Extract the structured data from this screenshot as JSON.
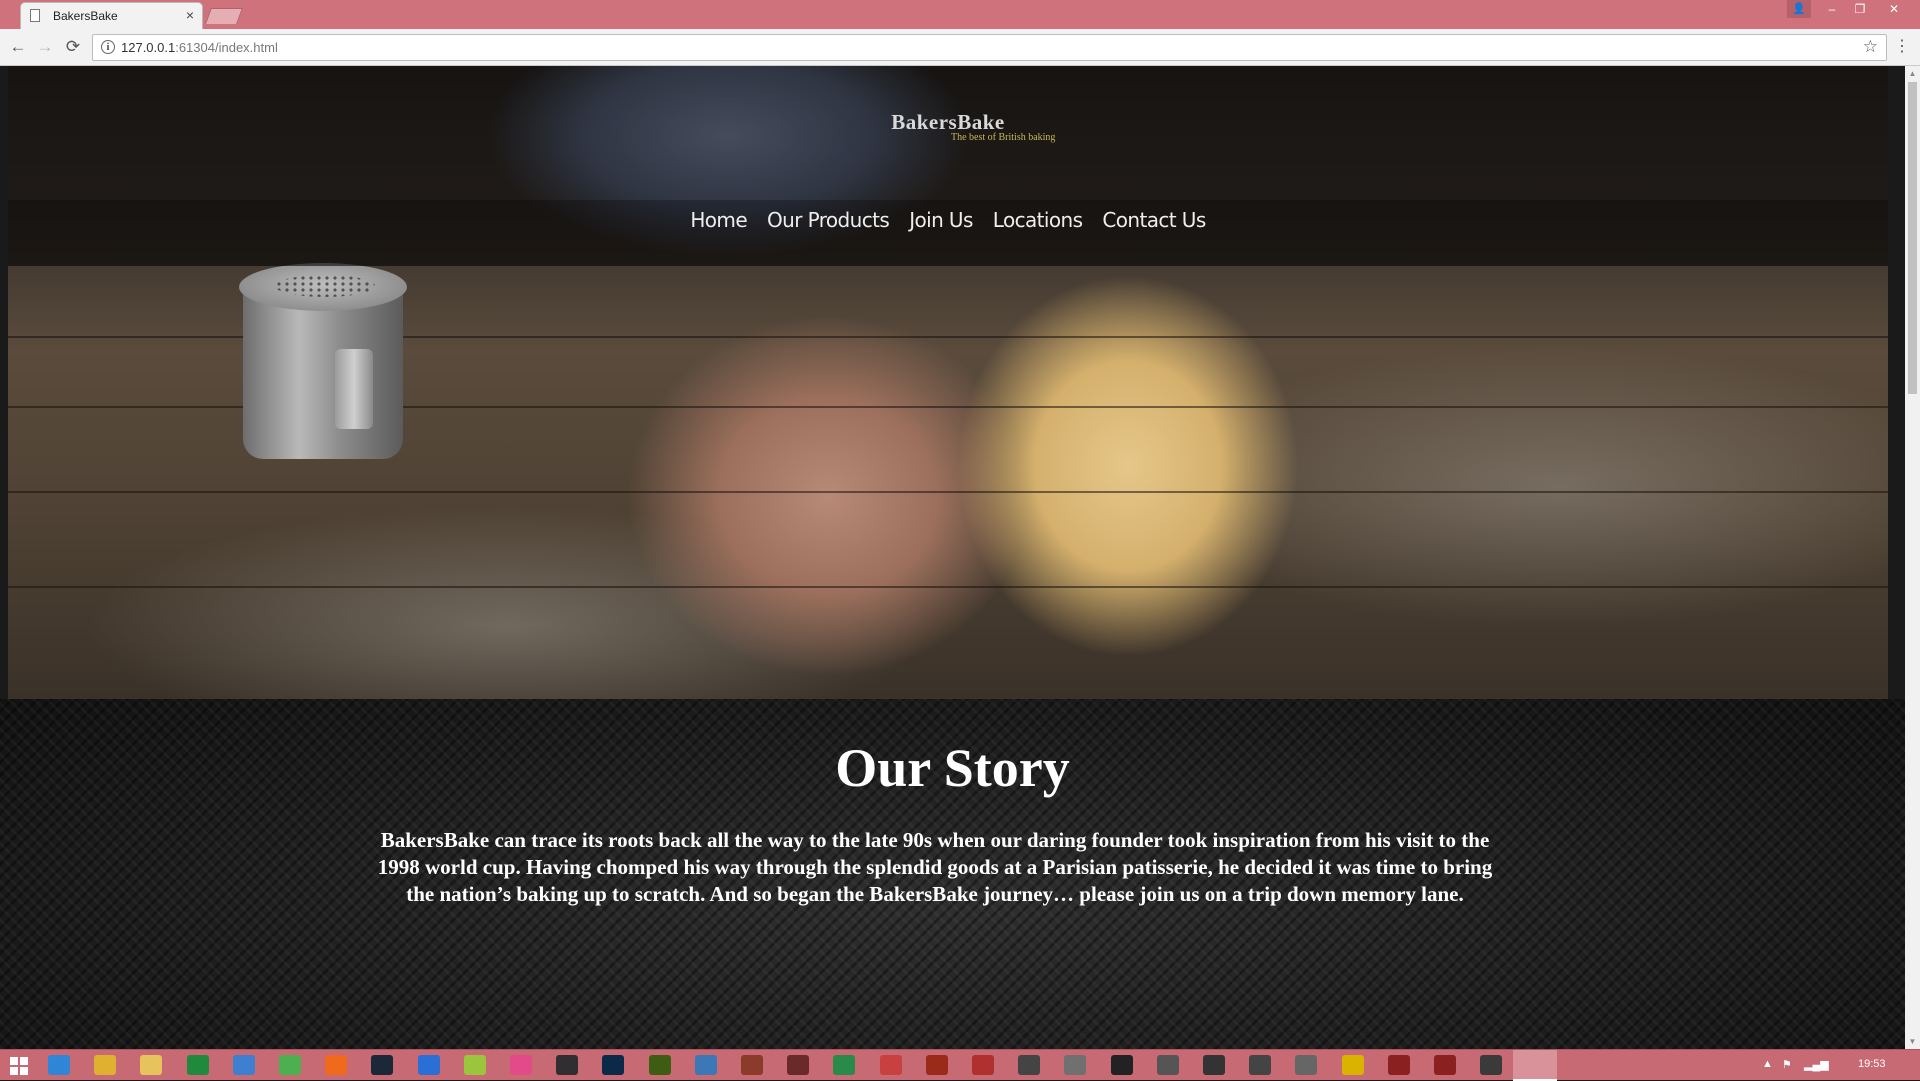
{
  "browser": {
    "tab_title": "BakersBake",
    "tab_close": "×",
    "url_host": "127.0.0.1",
    "url_rest": ":61304/index.html",
    "back": "←",
    "forward": "→",
    "reload": "⟳",
    "star": "☆",
    "menu": "⋮",
    "info": "i"
  },
  "window_controls": {
    "minimize": "–",
    "restore": "❐",
    "close": "✕",
    "user": "👤"
  },
  "site": {
    "brand_name": "BakersBake",
    "tagline": "The best of British baking",
    "nav": [
      "Home",
      "Our Products",
      "Join Us",
      "Locations",
      "Contact Us"
    ]
  },
  "story": {
    "heading": "Our Story",
    "body": "BakersBake can trace its roots back all the way to the late 90s when our daring founder took inspiration from his visit to the 1998 world cup. Having chomped his way through the splendid goods at a Parisian patisserie, he decided it was time to bring the nation’s baking up to scratch. And so began the BakersBake journey… please join us on a trip down memory lane."
  },
  "taskbar": {
    "clock": "19:53",
    "pinned_icons": [
      {
        "name": "ie-icon",
        "color": "#2f86d6"
      },
      {
        "name": "chrome-icon",
        "color": "#e0b030"
      },
      {
        "name": "file-explorer-icon",
        "color": "#e6c35c"
      },
      {
        "name": "excel-icon",
        "color": "#1f8a3c"
      },
      {
        "name": "keyboard-icon",
        "color": "#3f7fd0"
      },
      {
        "name": "green-app-icon",
        "color": "#4caf50"
      },
      {
        "name": "orange-app-icon",
        "color": "#f06a1e"
      },
      {
        "name": "steam-icon",
        "color": "#1b2838"
      },
      {
        "name": "blue-app-icon",
        "color": "#2a6fd6"
      },
      {
        "name": "lime-app-icon",
        "color": "#9bc53d"
      },
      {
        "name": "pink-app-icon",
        "color": "#e24a8a"
      },
      {
        "name": "obs-icon",
        "color": "#302e31"
      },
      {
        "name": "photoshop-icon",
        "color": "#0b2a4a"
      },
      {
        "name": "dreamweaver-icon",
        "color": "#3d5e12"
      },
      {
        "name": "visual-studio-icon",
        "color": "#3c78b5"
      },
      {
        "name": "game-app-icon-1",
        "color": "#8c3a2a"
      },
      {
        "name": "game-app-icon-2",
        "color": "#6b2a2a"
      },
      {
        "name": "game-app-icon-3",
        "color": "#2a8a4a"
      },
      {
        "name": "game-app-icon-4",
        "color": "#c94040"
      },
      {
        "name": "game-app-icon-5",
        "color": "#9a2a1a"
      },
      {
        "name": "game-app-icon-6",
        "color": "#b03030"
      },
      {
        "name": "game-app-icon-7",
        "color": "#444444"
      },
      {
        "name": "game-app-icon-8",
        "color": "#707070"
      },
      {
        "name": "game-app-icon-9",
        "color": "#222222"
      },
      {
        "name": "game-app-icon-10",
        "color": "#555555"
      },
      {
        "name": "game-app-icon-11",
        "color": "#333333"
      },
      {
        "name": "game-app-icon-12",
        "color": "#444444"
      },
      {
        "name": "game-app-icon-13",
        "color": "#666666"
      },
      {
        "name": "game-app-icon-14",
        "color": "#d9b300"
      },
      {
        "name": "game-app-icon-15",
        "color": "#8a2020"
      },
      {
        "name": "game-app-icon-16",
        "color": "#8a2020"
      },
      {
        "name": "game-app-icon-17",
        "color": "#3a3a3a"
      }
    ]
  }
}
